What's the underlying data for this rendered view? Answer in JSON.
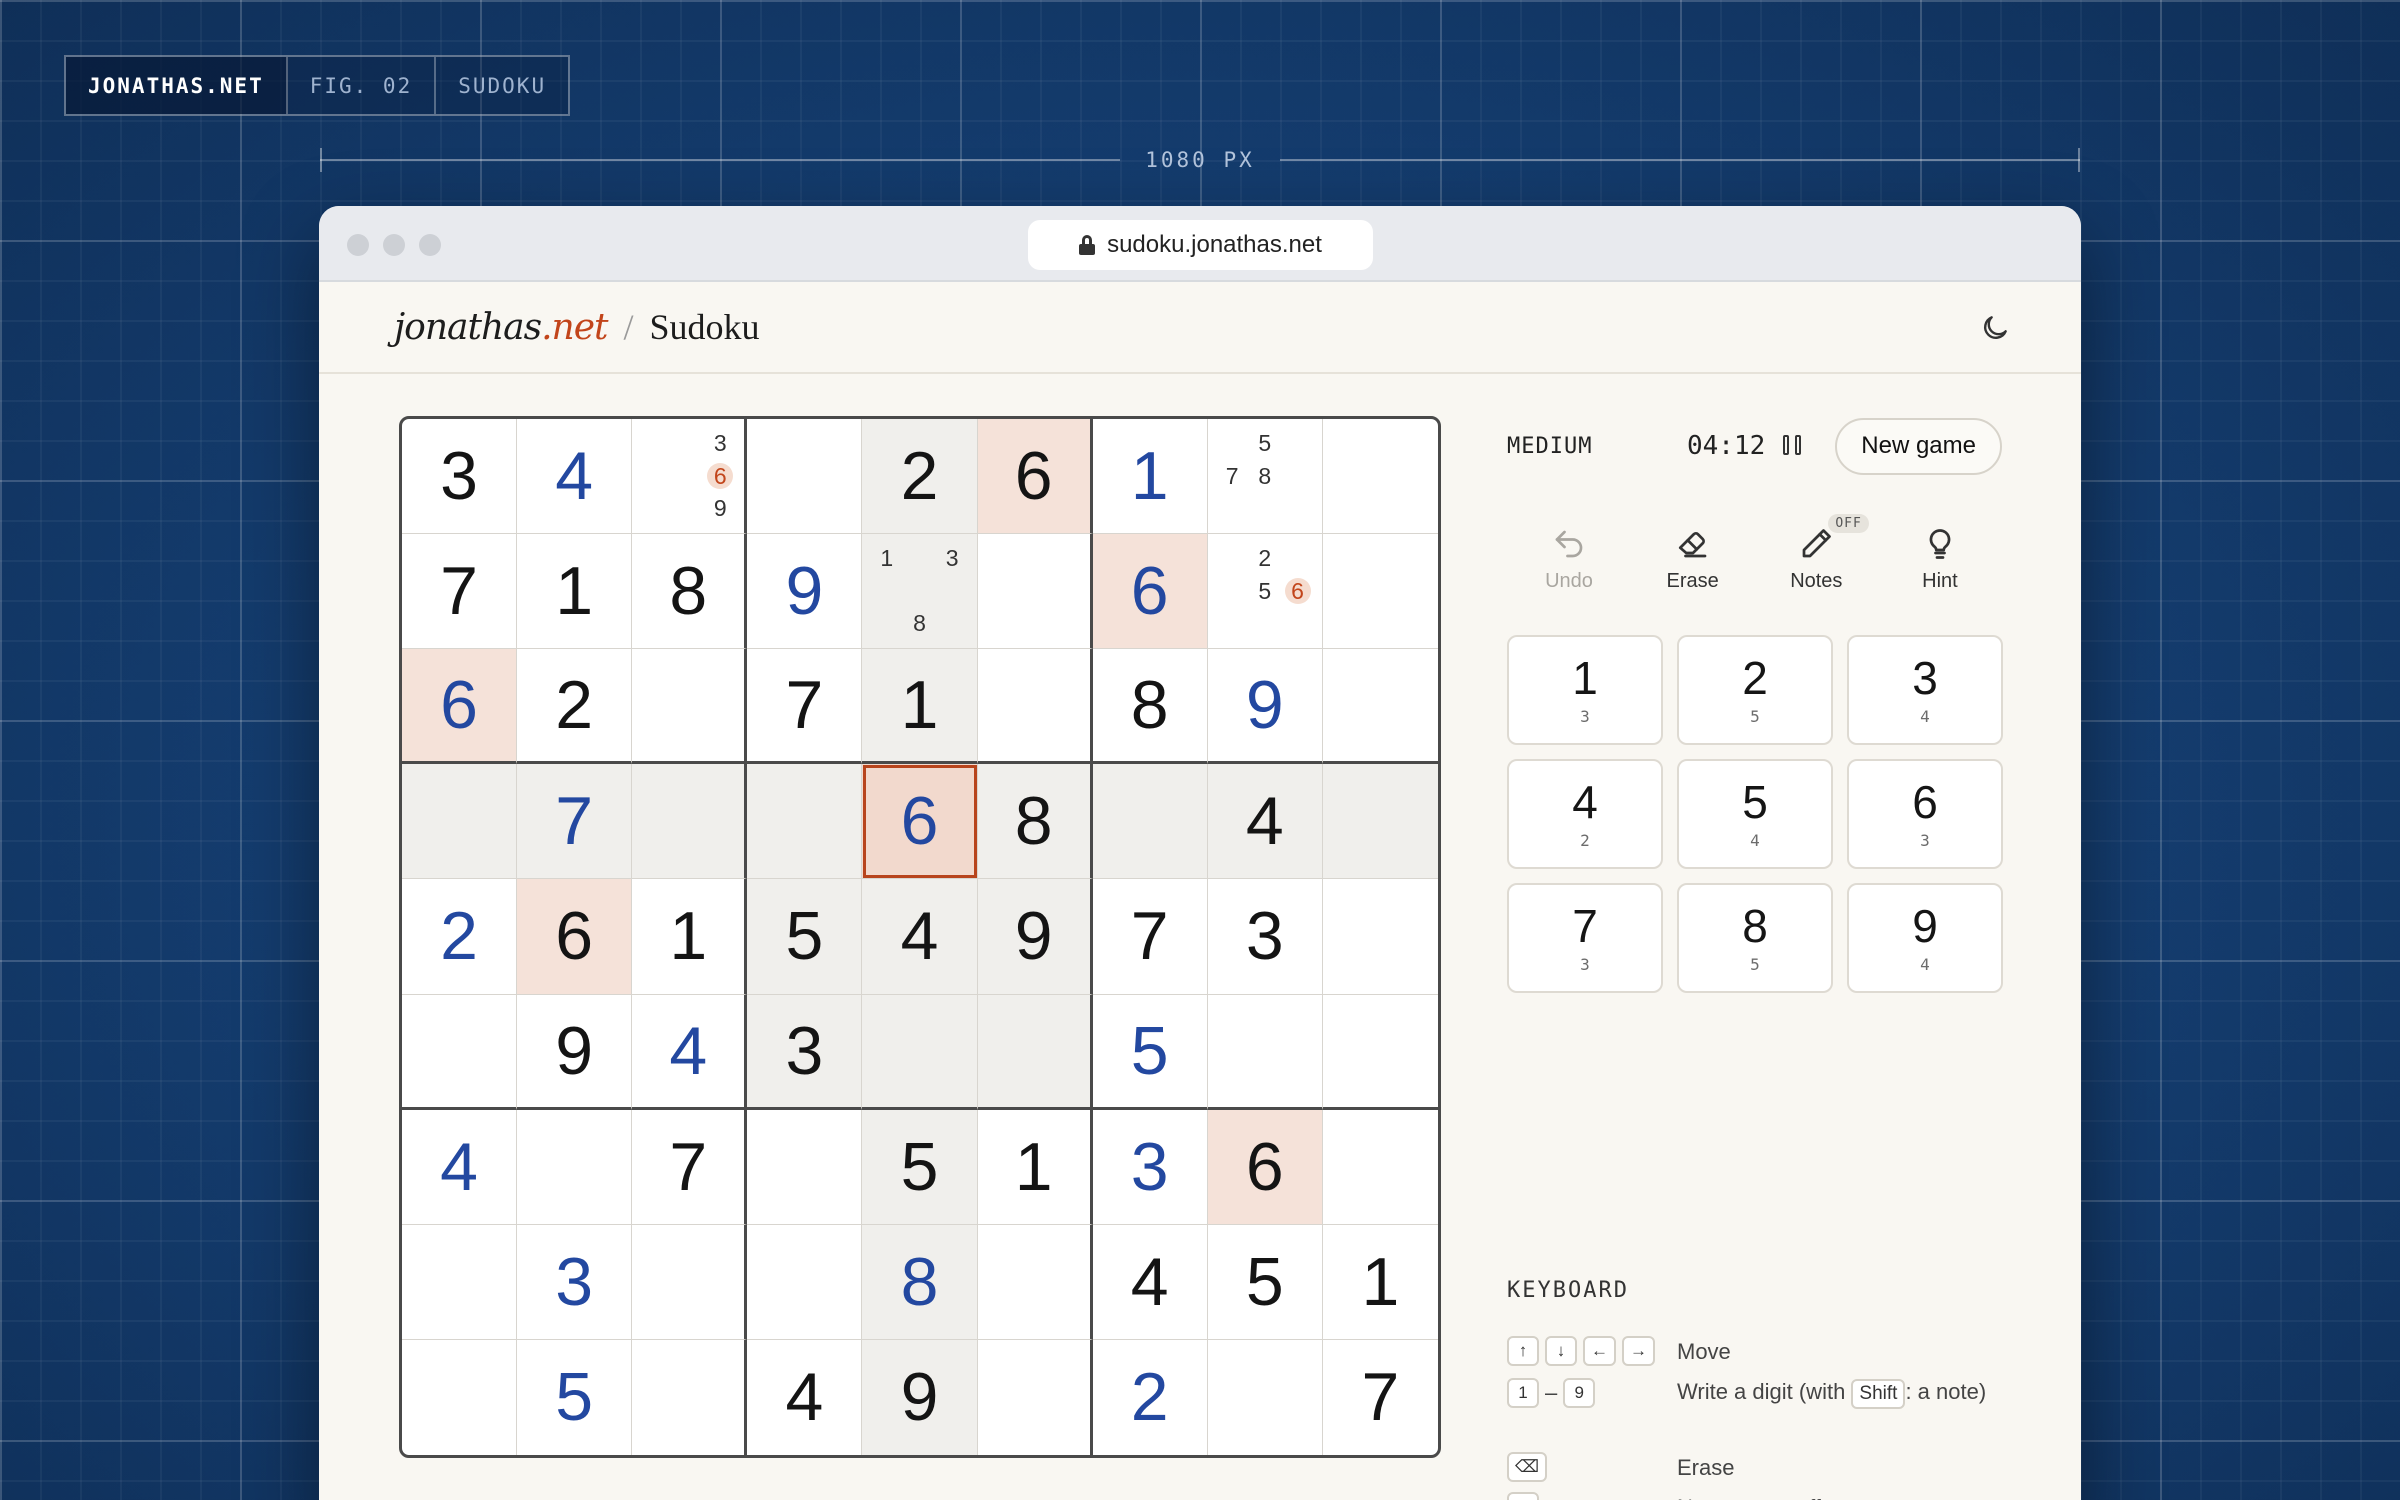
{
  "figtag": {
    "brand": "JONATHAS.NET",
    "fig": "FIG. 02",
    "name": "SUDOKU"
  },
  "ruler": {
    "label": "1080 PX"
  },
  "browser": {
    "url": "sudoku.jonathas.net"
  },
  "app": {
    "logo_main": "jonathas",
    "logo_tld": ".net",
    "separator": "/",
    "title": "Sudoku",
    "theme_icon": "moon-icon"
  },
  "game": {
    "difficulty": "MEDIUM",
    "timer": "04:12",
    "new_game_label": "New game",
    "tools": [
      {
        "label": "Undo",
        "icon": "undo-icon",
        "enabled": false
      },
      {
        "label": "Erase",
        "icon": "eraser-icon",
        "enabled": true
      },
      {
        "label": "Notes",
        "icon": "pencil-icon",
        "enabled": true,
        "badge": "OFF"
      },
      {
        "label": "Hint",
        "icon": "lightbulb-icon",
        "enabled": true
      }
    ],
    "numpad": [
      {
        "digit": "1",
        "remaining": "3"
      },
      {
        "digit": "2",
        "remaining": "5"
      },
      {
        "digit": "3",
        "remaining": "4"
      },
      {
        "digit": "4",
        "remaining": "2"
      },
      {
        "digit": "5",
        "remaining": "4"
      },
      {
        "digit": "6",
        "remaining": "3"
      },
      {
        "digit": "7",
        "remaining": "3"
      },
      {
        "digit": "8",
        "remaining": "5"
      },
      {
        "digit": "9",
        "remaining": "4"
      }
    ]
  },
  "board": {
    "selected": [
      3,
      4
    ],
    "highlight_digit": "6",
    "cells": [
      [
        {
          "v": "3",
          "t": "given"
        },
        {
          "v": "4",
          "t": "user"
        },
        {
          "notes": [
            "",
            "",
            "3",
            "",
            "",
            "6",
            "",
            "",
            "9"
          ]
        },
        {
          "v": ""
        },
        {
          "v": "2",
          "t": "given"
        },
        {
          "v": "6",
          "t": "given"
        },
        {
          "v": "1",
          "t": "user"
        },
        {
          "notes": [
            "",
            "5",
            "",
            "7",
            "8",
            "",
            "",
            "",
            ""
          ]
        },
        {
          "v": ""
        }
      ],
      [
        {
          "v": "7",
          "t": "given"
        },
        {
          "v": "1",
          "t": "given"
        },
        {
          "v": "8",
          "t": "given"
        },
        {
          "v": "9",
          "t": "user"
        },
        {
          "notes": [
            "1",
            "",
            "3",
            "",
            "",
            "",
            "",
            "8",
            ""
          ]
        },
        {
          "v": ""
        },
        {
          "v": "6",
          "t": "user"
        },
        {
          "notes": [
            "",
            "2",
            "",
            "",
            "5",
            "6",
            "",
            "",
            ""
          ]
        },
        {
          "v": ""
        }
      ],
      [
        {
          "v": "6",
          "t": "user"
        },
        {
          "v": "2",
          "t": "given"
        },
        {
          "v": ""
        },
        {
          "v": "7",
          "t": "given"
        },
        {
          "v": "1",
          "t": "given"
        },
        {
          "v": ""
        },
        {
          "v": "8",
          "t": "given"
        },
        {
          "v": "9",
          "t": "user"
        },
        {
          "v": ""
        }
      ],
      [
        {
          "v": ""
        },
        {
          "v": "7",
          "t": "user"
        },
        {
          "v": ""
        },
        {
          "v": ""
        },
        {
          "v": "6",
          "t": "user"
        },
        {
          "v": "8",
          "t": "given"
        },
        {
          "v": ""
        },
        {
          "v": "4",
          "t": "given"
        },
        {
          "v": ""
        }
      ],
      [
        {
          "v": "2",
          "t": "user"
        },
        {
          "v": "6",
          "t": "given"
        },
        {
          "v": "1",
          "t": "given"
        },
        {
          "v": "5",
          "t": "given"
        },
        {
          "v": "4",
          "t": "given"
        },
        {
          "v": "9",
          "t": "given"
        },
        {
          "v": "7",
          "t": "given"
        },
        {
          "v": "3",
          "t": "given"
        },
        {
          "v": ""
        }
      ],
      [
        {
          "v": ""
        },
        {
          "v": "9",
          "t": "given"
        },
        {
          "v": "4",
          "t": "user"
        },
        {
          "v": "3",
          "t": "given"
        },
        {
          "v": ""
        },
        {
          "v": ""
        },
        {
          "v": "5",
          "t": "user"
        },
        {
          "v": ""
        },
        {
          "v": ""
        }
      ],
      [
        {
          "v": "4",
          "t": "user"
        },
        {
          "v": ""
        },
        {
          "v": "7",
          "t": "given"
        },
        {
          "v": ""
        },
        {
          "v": "5",
          "t": "given"
        },
        {
          "v": "1",
          "t": "given"
        },
        {
          "v": "3",
          "t": "user"
        },
        {
          "v": "6",
          "t": "given"
        },
        {
          "v": ""
        }
      ],
      [
        {
          "v": ""
        },
        {
          "v": "3",
          "t": "user"
        },
        {
          "v": ""
        },
        {
          "v": ""
        },
        {
          "v": "8",
          "t": "user"
        },
        {
          "v": ""
        },
        {
          "v": "4",
          "t": "given"
        },
        {
          "v": "5",
          "t": "given"
        },
        {
          "v": "1",
          "t": "given"
        }
      ],
      [
        {
          "v": ""
        },
        {
          "v": "5",
          "t": "user"
        },
        {
          "v": ""
        },
        {
          "v": "4",
          "t": "given"
        },
        {
          "v": "9",
          "t": "given"
        },
        {
          "v": ""
        },
        {
          "v": "2",
          "t": "user"
        },
        {
          "v": ""
        },
        {
          "v": "7",
          "t": "given"
        }
      ]
    ]
  },
  "keyboard": {
    "title": "KEYBOARD",
    "rows": [
      {
        "keys": [
          "↑",
          "↓",
          "←",
          "→"
        ],
        "sep": "",
        "desc": "Move"
      },
      {
        "keys": [
          "1",
          "9"
        ],
        "sep": "–",
        "desc_before": "Write a digit (with ",
        "desc_key": "Shift",
        "desc_after": ": a note)"
      },
      {
        "keys": [
          "⌫"
        ],
        "sep": "",
        "desc": "Erase"
      },
      {
        "keys": [
          "N"
        ],
        "sep": "",
        "desc": "Notes on or off"
      }
    ]
  },
  "colors": {
    "background": "#123766",
    "given_digit": "#141414",
    "user_digit": "#2348a0",
    "accent": "#c2451b",
    "selected_bg": "#f2d9cd",
    "same_digit_bg": "#f5e2d9",
    "peer_bg": "#f0efec"
  }
}
